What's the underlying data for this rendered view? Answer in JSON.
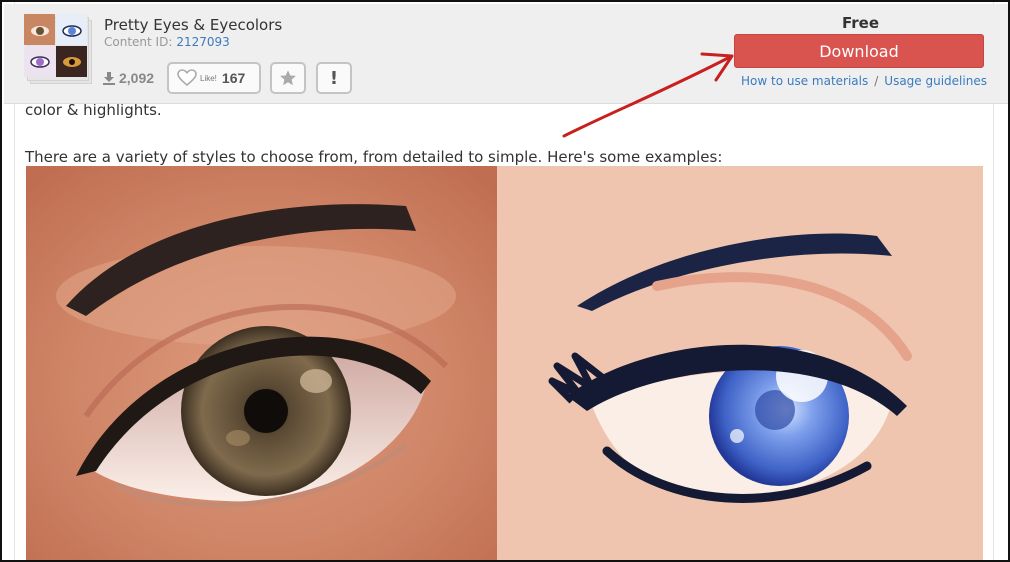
{
  "header": {
    "title": "Pretty Eyes & Eyecolors",
    "content_id_label": "Content ID:",
    "content_id": "2127093",
    "downloads": "2,092",
    "like_label": "Like!",
    "like_count": "167",
    "report_label": "!",
    "price": "Free",
    "download_label": "Download",
    "how_to_label": "How to use materials",
    "separator": "/",
    "guidelines_label": "Usage guidelines"
  },
  "body": {
    "para1": "color & highlights.",
    "para2": "There are a variety of styles to choose from, from detailed to simple.  Here's some examples:"
  },
  "icons": {
    "download": "download-icon",
    "like": "heart-icon",
    "favorite": "star-icon",
    "report": "exclamation-icon"
  },
  "colors": {
    "download_button": "#d9534f",
    "link": "#3a7bbf",
    "header_bg": "#efefef",
    "annotation_arrow": "#c8201f",
    "left_example_bg": "#c9775a",
    "right_example_bg": "#efc5b0"
  }
}
